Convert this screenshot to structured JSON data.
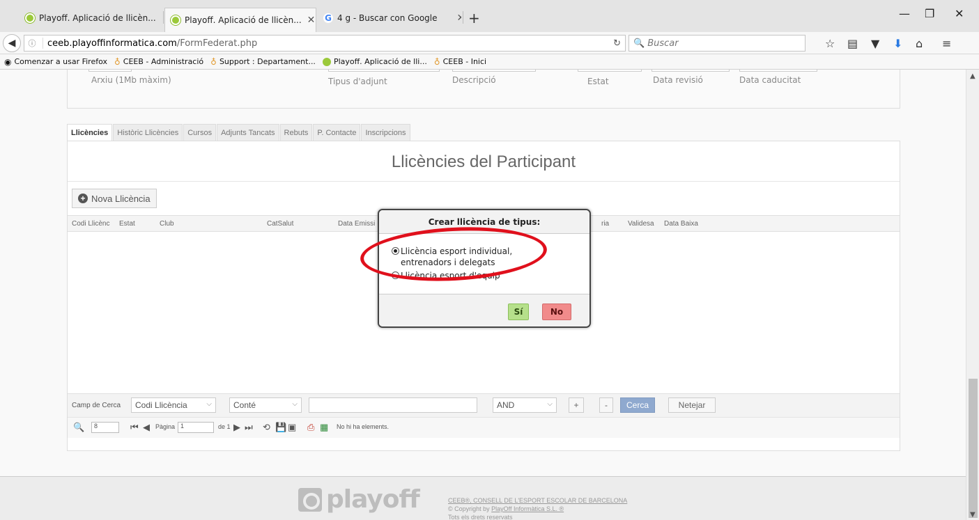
{
  "browser": {
    "tabs": [
      {
        "title": "Playoff. Aplicació de llicèn...",
        "icon": "playoff-icon",
        "active": false
      },
      {
        "title": "Playoff. Aplicació de llicèn...",
        "icon": "playoff-icon",
        "active": true
      },
      {
        "title": "4 g - Buscar con Google",
        "icon": "google-icon",
        "active": false
      }
    ],
    "url_host": "ceeb.playoffinformatica.com",
    "url_path": "/FormFederat.php",
    "search_placeholder": "Buscar",
    "bookmarks": [
      {
        "label": "Comenzar a usar Firefox",
        "icon": "firefox-icon"
      },
      {
        "label": "CEEB - Administració",
        "icon": "flame-icon"
      },
      {
        "label": "Support : Departament...",
        "icon": "flame-icon"
      },
      {
        "label": "Playoff. Aplicació de lli...",
        "icon": "playoff-icon"
      },
      {
        "label": "CEEB - Inici",
        "icon": "flame-icon"
      }
    ]
  },
  "upper_panel": {
    "labels": {
      "file": "Arxiu (1Mb màxim)",
      "attach_type": "Tipus d'adjunt",
      "description": "Descripció",
      "status": "Estat",
      "review_date": "Data revisió",
      "expiry_date": "Data caducitat"
    }
  },
  "tabs": [
    "Llicències",
    "Històric Llicències",
    "Cursos",
    "Adjunts Tancats",
    "Rebuts",
    "P. Contacte",
    "Inscripcions"
  ],
  "panel": {
    "title": "Llicències del Participant",
    "new_button": "Nova Llicència",
    "columns": {
      "code": "Codi Llicènc",
      "status": "Estat",
      "club": "Club",
      "catsalut": "CatSalut",
      "issue_date": "Data Emissi",
      "category": "ria",
      "validity": "Validesa",
      "drop_date": "Data Baixa"
    }
  },
  "search": {
    "label": "Camp de Cerca",
    "field": "Codi Llicència",
    "operator": "Conté",
    "value": "",
    "logic": "AND",
    "add": "+",
    "remove": "-",
    "search_button": "Cerca",
    "clear_button": "Netejar"
  },
  "pager": {
    "page_size": "8",
    "page_label": "Pàgina",
    "page": "1",
    "of": "de 1",
    "status": "No hi ha elements."
  },
  "footer": {
    "logo": "playoff",
    "line1": "CEEB®, CONSELL DE L'ESPORT ESCOLAR DE BARCELONA",
    "line2_prefix": "© Copyright by ",
    "line2_link": "PlayOff Informàtica S.L. ®",
    "line3": "Tots els drets reservats"
  },
  "dialog": {
    "title": "Crear llicència de tipus:",
    "option1": "Llicència esport individual, entrenadors i delegats",
    "option2": "Llicència esport d'equip",
    "option1_selected": true,
    "yes": "Sí",
    "no": "No"
  },
  "colors": {
    "yes_bg": "#b6e08b",
    "no_bg": "#f18b8b",
    "annotation": "#e0101c",
    "search_btn": "#8fa9cf"
  }
}
